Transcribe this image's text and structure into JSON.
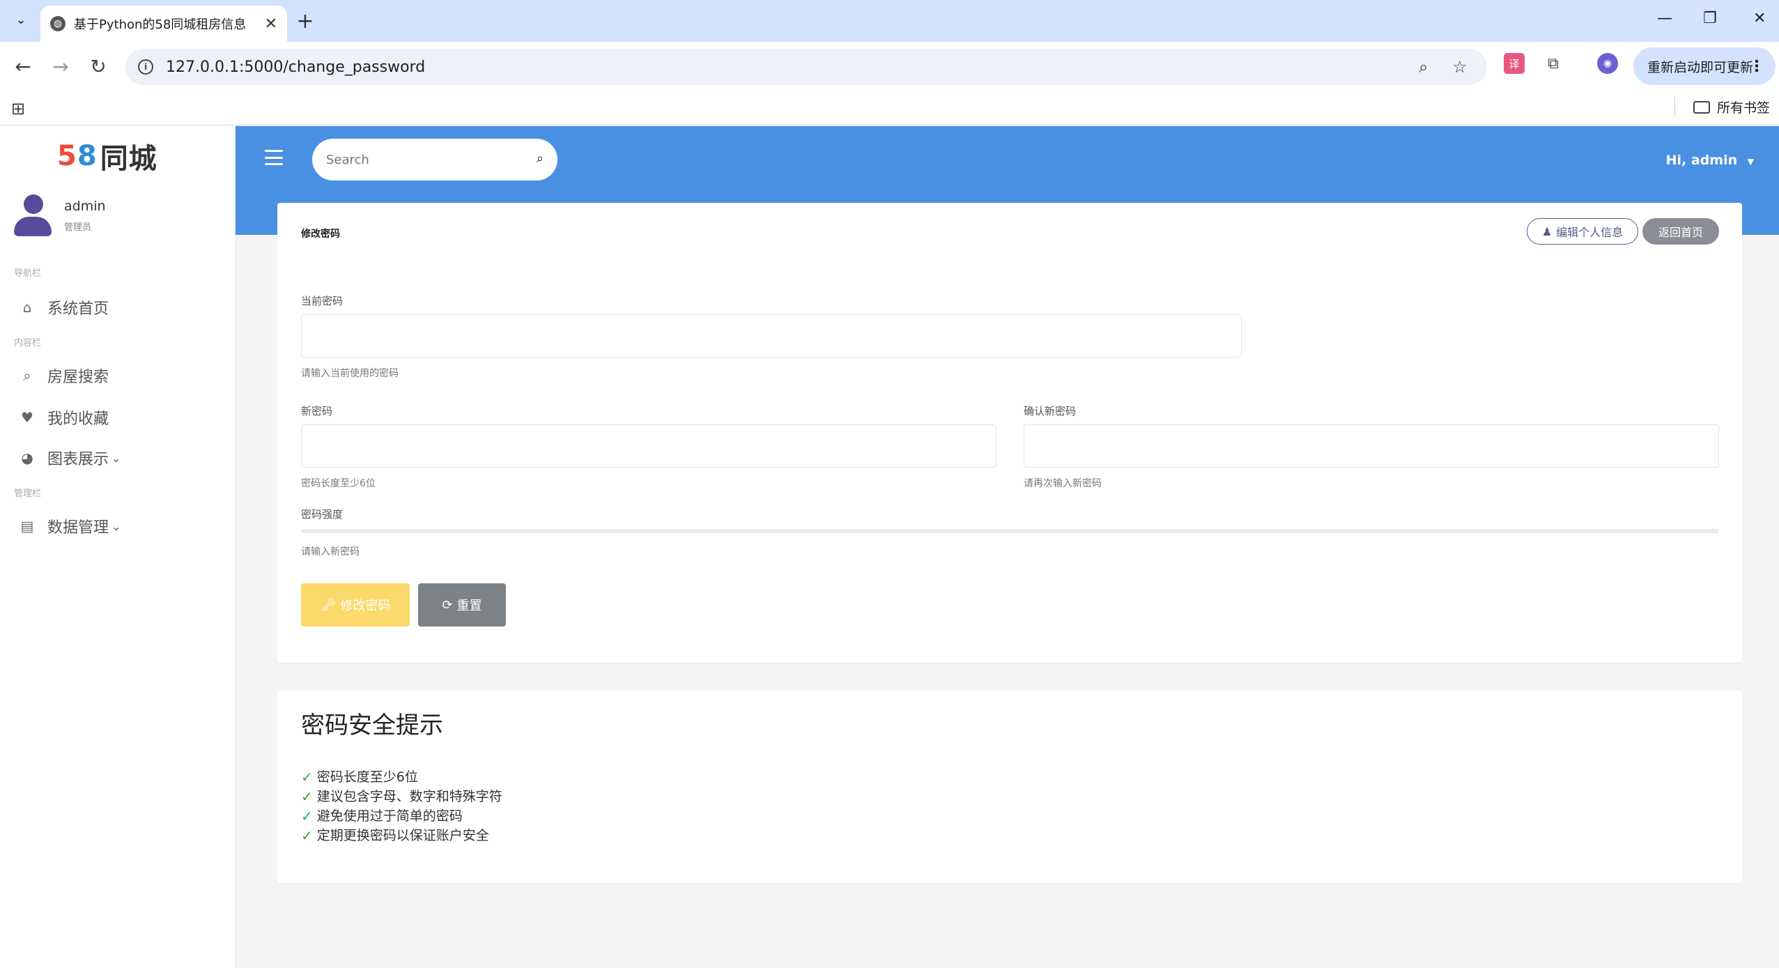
{
  "browser": {
    "tab_title": "基于Python的58同城租房信息",
    "new_tab": "+",
    "url": "127.0.0.1:5000/change_password",
    "update_label": "重新启动即可更新",
    "bookmarks_all": "所有书签"
  },
  "sidebar": {
    "logo_5": "5",
    "logo_8": "8",
    "logo_text": "同城",
    "user_name": "admin",
    "user_role": "管理员",
    "sections": {
      "nav": "导航栏",
      "content": "内容栏",
      "manage": "管理栏"
    },
    "items": [
      {
        "label": "系统首页",
        "icon": "home-icon"
      },
      {
        "label": "房屋搜索",
        "icon": "search-icon"
      },
      {
        "label": "我的收藏",
        "icon": "heart-icon"
      },
      {
        "label": "图表展示",
        "icon": "pie-chart-icon"
      },
      {
        "label": "数据管理",
        "icon": "document-icon"
      }
    ]
  },
  "topbar": {
    "search_placeholder": "Search",
    "greeting": "Hi, admin"
  },
  "form": {
    "title": "修改密码",
    "edit_profile_label": "编辑个人信息",
    "back_home_label": "返回首页",
    "current_label": "当前密码",
    "current_help": "请输入当前使用的密码",
    "new_label": "新密码",
    "new_help": "密码长度至少6位",
    "confirm_label": "确认新密码",
    "confirm_help": "请再次输入新密码",
    "strength_label": "密码强度",
    "strength_help": "请输入新密码",
    "strength_value": 0,
    "submit_label": "修改密码",
    "reset_label": "重置"
  },
  "tips": {
    "title": "密码安全提示",
    "items": [
      "密码长度至少6位",
      "建议包含字母、数字和特殊字符",
      "避免使用过于简单的密码",
      "定期更换密码以保证账户安全"
    ]
  },
  "colors": {
    "topbar": "#4a90e2",
    "submit": "#fbd96a",
    "reset": "#7d8287",
    "check": "#28a745"
  }
}
